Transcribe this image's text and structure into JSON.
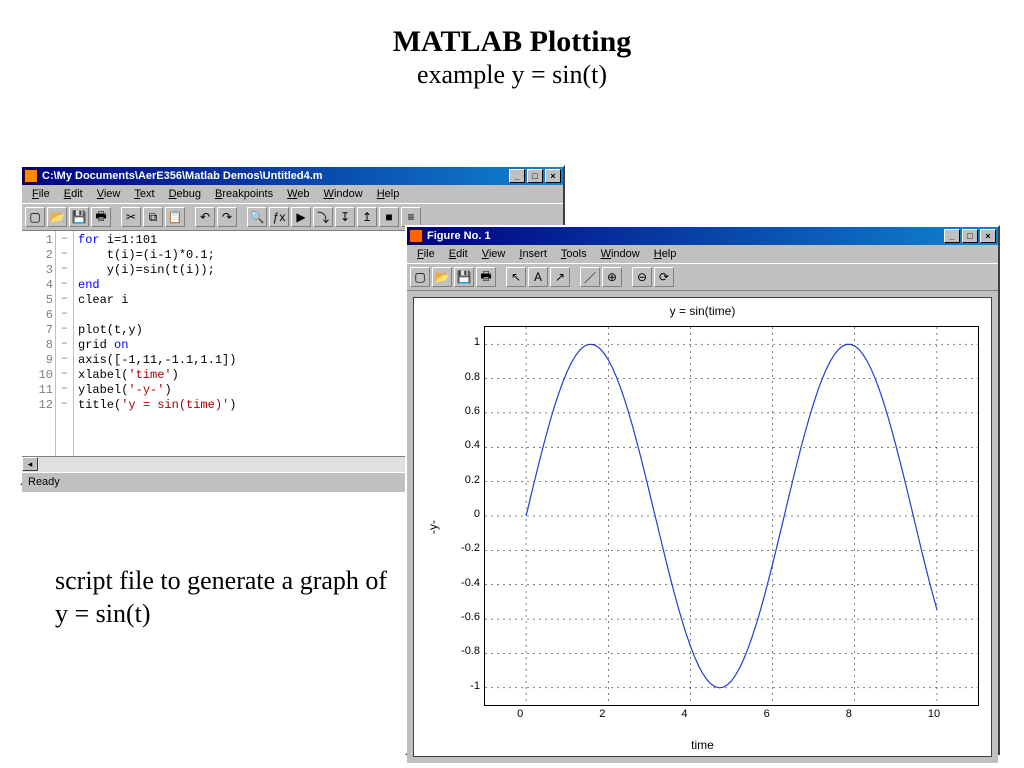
{
  "slide": {
    "title": "MATLAB Plotting",
    "subtitle": "example y = sin(t)",
    "caption": "script file to generate a graph of y = sin(t)"
  },
  "editor": {
    "title": "C:\\My Documents\\AerE356\\Matlab Demos\\Untitled4.m",
    "menubar": [
      "File",
      "Edit",
      "View",
      "Text",
      "Debug",
      "Breakpoints",
      "Web",
      "Window",
      "Help"
    ],
    "toolbar_icons": [
      "new",
      "open",
      "save",
      "print",
      "cut",
      "copy",
      "paste",
      "undo",
      "redo",
      "find",
      "fx",
      "run",
      "step",
      "step-in",
      "step-out",
      "stop",
      "stack"
    ],
    "status": "Ready",
    "code_lines": [
      {
        "n": 1,
        "tokens": [
          {
            "t": "for",
            "c": "kw"
          },
          {
            "t": " i=1:101"
          }
        ]
      },
      {
        "n": 2,
        "tokens": [
          {
            "t": "    t(i)=(i-1)*0.1;"
          }
        ]
      },
      {
        "n": 3,
        "tokens": [
          {
            "t": "    y(i)=sin(t(i));"
          }
        ]
      },
      {
        "n": 4,
        "tokens": [
          {
            "t": "end",
            "c": "kw"
          }
        ]
      },
      {
        "n": 5,
        "tokens": [
          {
            "t": "clear i"
          }
        ]
      },
      {
        "n": 6,
        "tokens": [
          {
            "t": ""
          }
        ]
      },
      {
        "n": 7,
        "tokens": [
          {
            "t": "plot(t,y)"
          }
        ]
      },
      {
        "n": 8,
        "tokens": [
          {
            "t": "grid "
          },
          {
            "t": "on",
            "c": "kw"
          }
        ]
      },
      {
        "n": 9,
        "tokens": [
          {
            "t": "axis([-1,11,-1.1,1.1])"
          }
        ]
      },
      {
        "n": 10,
        "tokens": [
          {
            "t": "xlabel("
          },
          {
            "t": "'time'",
            "c": "str"
          },
          {
            "t": ")"
          }
        ]
      },
      {
        "n": 11,
        "tokens": [
          {
            "t": "ylabel("
          },
          {
            "t": "'-y-'",
            "c": "str"
          },
          {
            "t": ")"
          }
        ]
      },
      {
        "n": 12,
        "tokens": [
          {
            "t": "title("
          },
          {
            "t": "'y = sin(time)'",
            "c": "str"
          },
          {
            "t": ")"
          }
        ]
      }
    ]
  },
  "figure": {
    "title": "Figure No. 1",
    "menubar": [
      "File",
      "Edit",
      "View",
      "Insert",
      "Tools",
      "Window",
      "Help"
    ],
    "toolbar_icons": [
      "new",
      "open",
      "save",
      "print",
      "pointer",
      "text",
      "arrow",
      "line",
      "zoom-in",
      "zoom-out",
      "rotate"
    ]
  },
  "chart_data": {
    "type": "line",
    "title": "y = sin(time)",
    "xlabel": "time",
    "ylabel": "-y-",
    "xlim": [
      -1,
      11
    ],
    "ylim": [
      -1.1,
      1.1
    ],
    "xticks": [
      0,
      2,
      4,
      6,
      8,
      10
    ],
    "yticks": [
      -1,
      -0.8,
      -0.6,
      -0.4,
      -0.2,
      0,
      0.2,
      0.4,
      0.6,
      0.8,
      1
    ],
    "grid": true,
    "series": [
      {
        "name": "sin(t)",
        "color": "#2040d0",
        "x_formula": "t = 0 .. 10 step 0.1",
        "y_formula": "y = sin(t)"
      }
    ]
  }
}
